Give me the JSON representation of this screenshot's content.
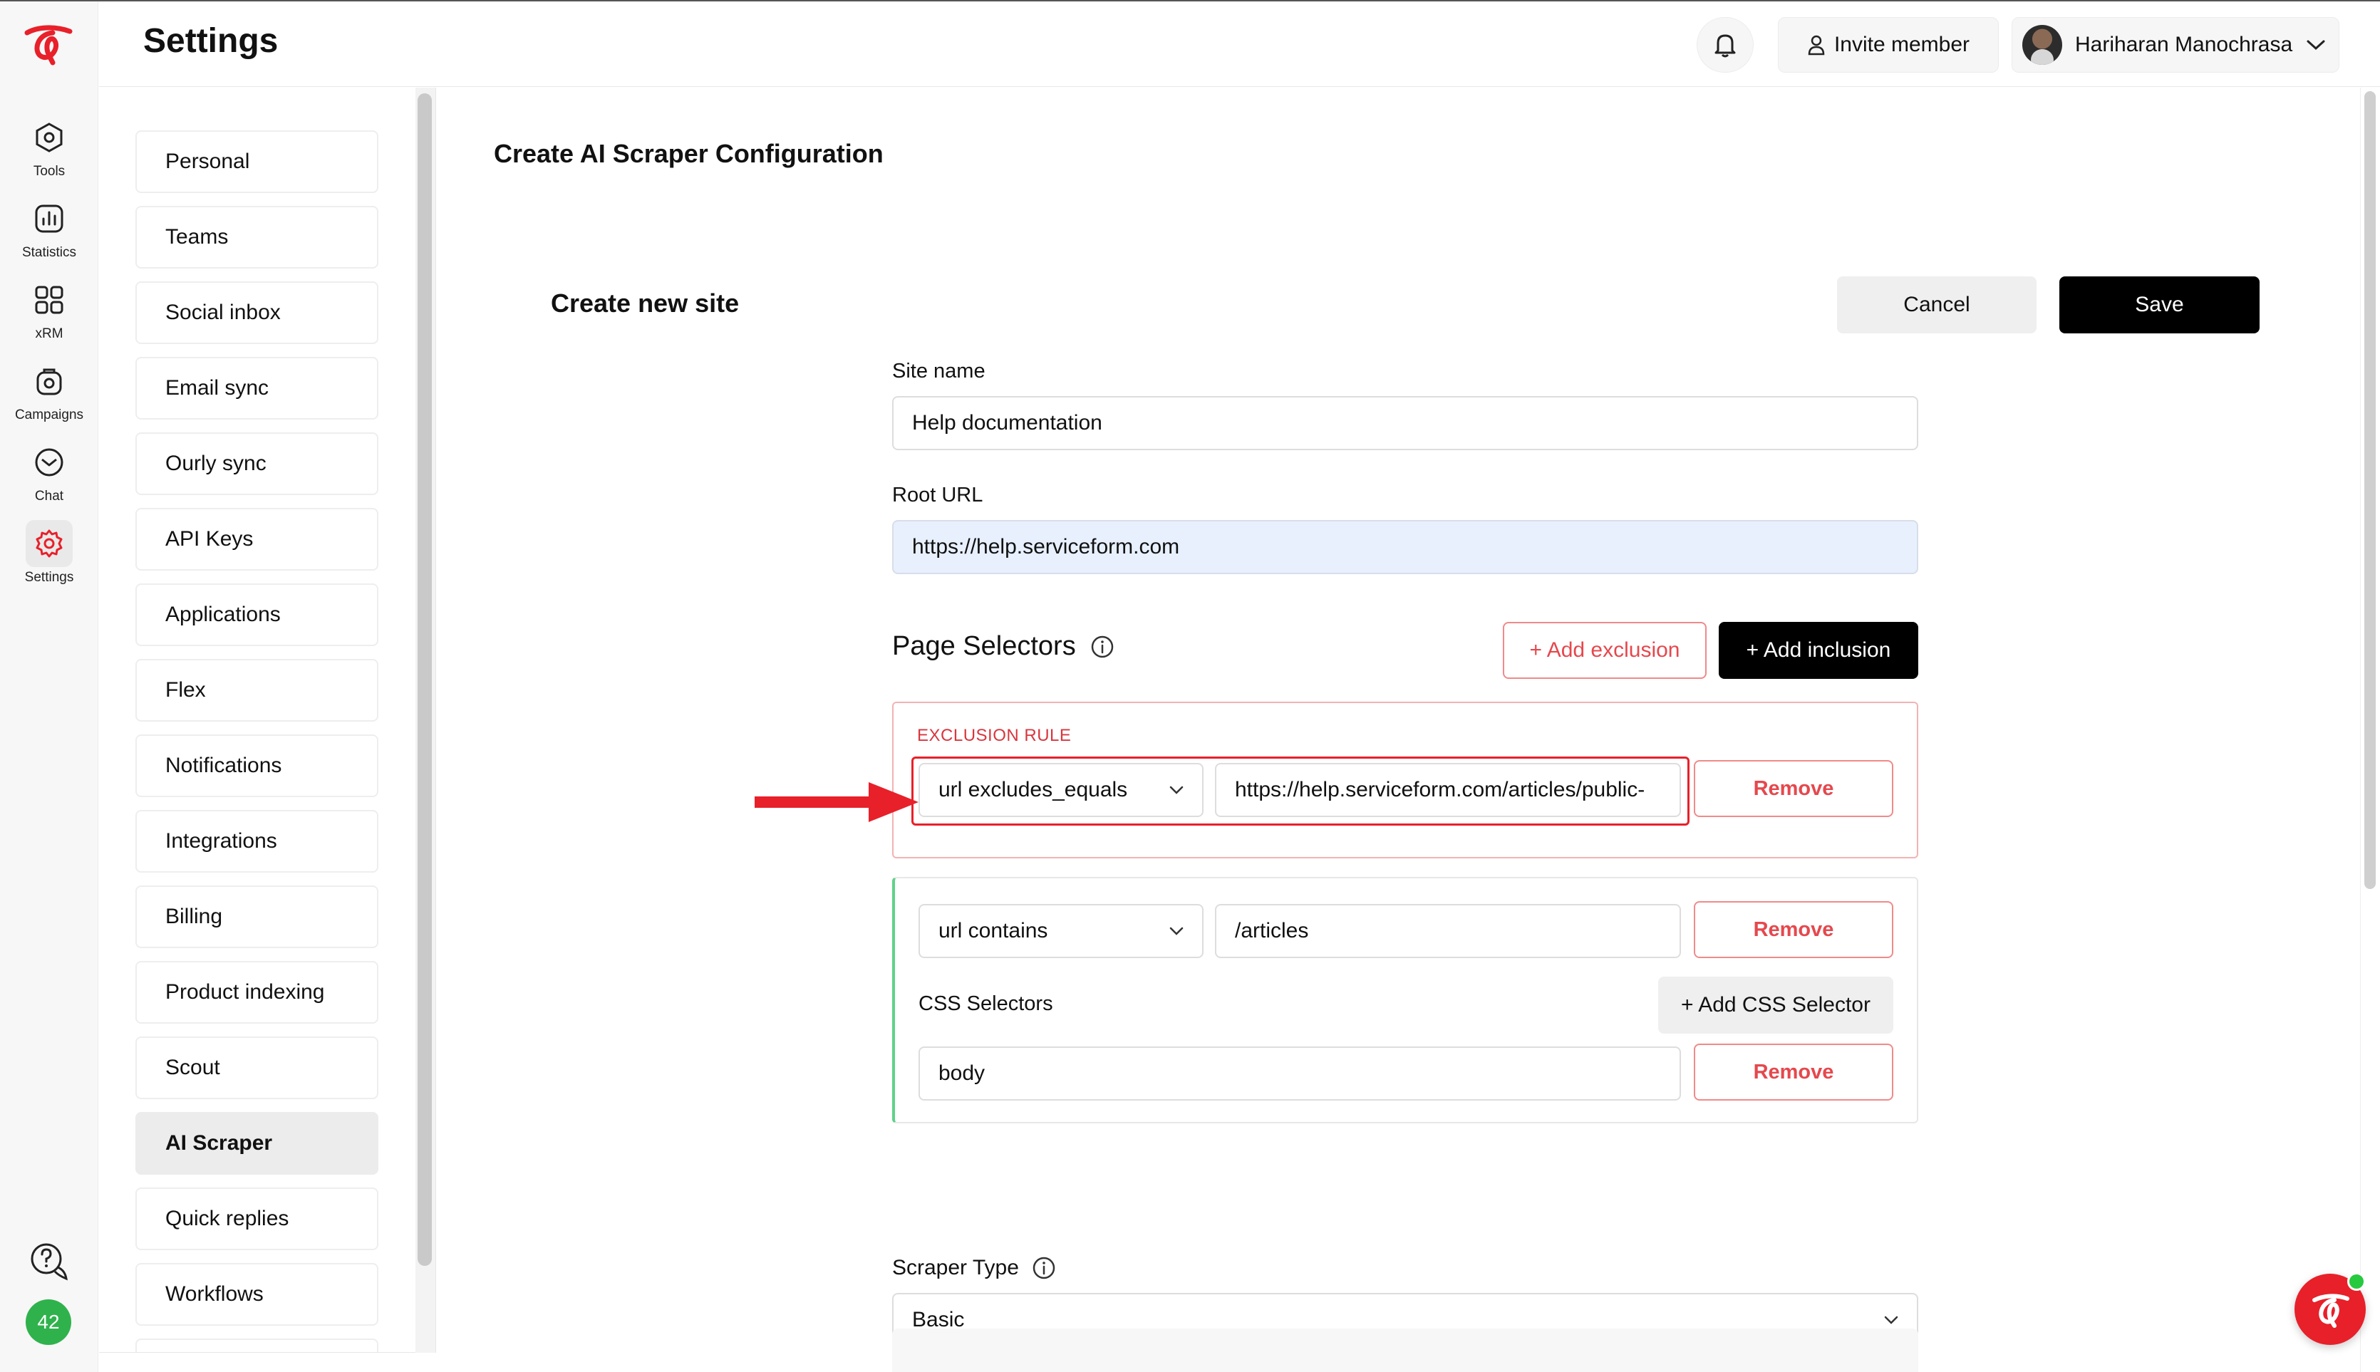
{
  "rail": {
    "items": [
      {
        "label": "Tools",
        "icon": "tools-icon"
      },
      {
        "label": "Statistics",
        "icon": "statistics-icon"
      },
      {
        "label": "xRM",
        "icon": "xrm-icon"
      },
      {
        "label": "Campaigns",
        "icon": "campaigns-icon"
      },
      {
        "label": "Chat",
        "icon": "chat-icon"
      },
      {
        "label": "Settings",
        "icon": "settings-icon"
      }
    ],
    "badge_count": "42"
  },
  "header": {
    "title": "Settings",
    "invite_label": "Invite member",
    "user_name": "Hariharan Manochrasa"
  },
  "settings_nav": {
    "items": [
      {
        "label": "Personal"
      },
      {
        "label": "Teams"
      },
      {
        "label": "Social inbox"
      },
      {
        "label": "Email sync"
      },
      {
        "label": "Ourly sync"
      },
      {
        "label": "API Keys"
      },
      {
        "label": "Applications"
      },
      {
        "label": "Flex"
      },
      {
        "label": "Notifications"
      },
      {
        "label": "Integrations"
      },
      {
        "label": "Billing"
      },
      {
        "label": "Product indexing"
      },
      {
        "label": "Scout"
      },
      {
        "label": "AI Scraper"
      },
      {
        "label": "Quick replies"
      },
      {
        "label": "Workflows"
      }
    ],
    "active": "AI Scraper"
  },
  "main": {
    "title": "Create AI Scraper Configuration",
    "section_title": "Create new site",
    "cancel_label": "Cancel",
    "save_label": "Save",
    "site_name_label": "Site name",
    "site_name_value": "Help documentation",
    "root_url_label": "Root URL",
    "root_url_value": "https://help.serviceform.com",
    "selectors_title": "Page Selectors",
    "add_exclusion_label": "+ Add exclusion",
    "add_inclusion_label": "+ Add inclusion",
    "exclusion": {
      "heading": "EXCLUSION RULE",
      "operator": "url excludes_equals",
      "value": "https://help.serviceform.com/articles/public-",
      "remove_label": "Remove"
    },
    "inclusion": {
      "operator": "url contains",
      "value": "/articles",
      "remove_label": "Remove",
      "css_label": "CSS Selectors",
      "add_css_label": "+ Add CSS Selector",
      "css_value": "body",
      "css_remove_label": "Remove"
    },
    "scraper_type_label": "Scraper Type",
    "scraper_type_value": "Basic"
  },
  "colors": {
    "brand_red": "#e8202a",
    "danger": "#e5484d",
    "inclusion_green": "#5fd18a",
    "badge_green": "#2fb24c"
  }
}
